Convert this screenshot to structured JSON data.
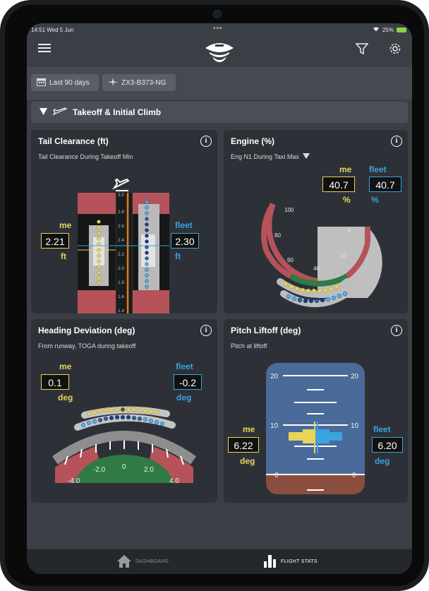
{
  "status_bar": {
    "time": "14:51  Wed 5 Jun",
    "battery": "25%"
  },
  "filters": {
    "date_range": "Last 90 days",
    "aircraft": "ZX3-B373-NG"
  },
  "section": {
    "title": "Takeoff & Initial Climb"
  },
  "cards": {
    "tail": {
      "title": "Tail Clearance (ft)",
      "subtitle": "Tail Clearance During Takeoff Min",
      "me_label": "me",
      "me_value": "2.21",
      "me_unit": "ft",
      "fleet_label": "fleet",
      "fleet_value": "2.30",
      "fleet_unit": "ft",
      "scale": [
        "3.0",
        "2.8",
        "2.6",
        "2.4",
        "2.2",
        "2.0",
        "1.8",
        "1.6",
        "1.4"
      ]
    },
    "engine": {
      "title": "Engine (%)",
      "subtitle": "Eng N1 During Taxi Max",
      "me_label": "me",
      "me_value": "40.7",
      "me_unit": "%",
      "fleet_label": "fleet",
      "fleet_value": "40.7",
      "fleet_unit": "%",
      "scale": [
        "100",
        "80",
        "60",
        "40",
        "20",
        "0"
      ]
    },
    "heading": {
      "title": "Heading Deviation (deg)",
      "subtitle": "From runway, TOGA during takeoff",
      "me_label": "me",
      "me_value": "0.1",
      "me_unit": "deg",
      "fleet_label": "fleet",
      "fleet_value": "-0.2",
      "fleet_unit": "deg",
      "scale": [
        "-4.0",
        "-2.0",
        "0",
        "2.0",
        "4.0"
      ]
    },
    "pitch": {
      "title": "Pitch Liftoff (deg)",
      "subtitle": "Pitch at liftoff",
      "me_label": "me",
      "me_value": "6.22",
      "me_unit": "deg",
      "fleet_label": "fleet",
      "fleet_value": "6.20",
      "fleet_unit": "deg",
      "scale": [
        "20",
        "10",
        "0"
      ]
    }
  },
  "tabs": {
    "dashboard": "DASHBOARD",
    "flight_stats": "FLIGHT STATS"
  },
  "colors": {
    "me": "#e8d45a",
    "fleet": "#3aa3e0",
    "danger": "#b5525a",
    "ok": "#2f7a45"
  }
}
